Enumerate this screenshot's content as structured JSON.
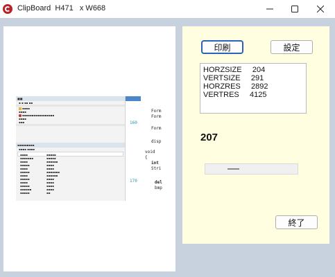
{
  "window": {
    "title": "ClipBoard  H471   x W668",
    "controls": {
      "minimize_icon": "minimize-icon",
      "maximize_icon": "maximize-icon",
      "close_icon": "close-icon"
    }
  },
  "buttons": {
    "print": "印刷",
    "settings": "設定",
    "exit": "終了"
  },
  "info": {
    "lines": [
      "HORZSIZE     204",
      "VERTSIZE     291",
      "HORZRES     2892",
      "VERTRES     4125"
    ]
  },
  "value_display": "207",
  "scroll": {
    "position": 0.25
  },
  "thumbnail": {
    "code_lines": [
      "Form",
      "Form",
      "Form",
      "disp",
      "void",
      "{",
      "int",
      "Stri",
      "del",
      "bmp"
    ],
    "line_numbers": [
      "160",
      "170"
    ]
  },
  "colors": {
    "panel_bg": "#fffee0",
    "window_bg": "#c8d2de",
    "accent_border": "#2a62b8",
    "app_icon": "#b8222a"
  }
}
